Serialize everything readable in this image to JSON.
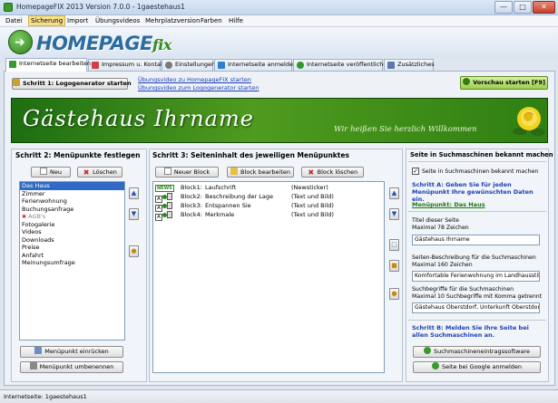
{
  "window": {
    "title": "HomepageFIX 2013 Version 7.0.0 - 1gaestehaus1",
    "controls": {
      "minimize": "—",
      "maximize": "□",
      "close": "✕"
    }
  },
  "menu": [
    {
      "label": "Datei",
      "active": false
    },
    {
      "label": "Sicherung",
      "active": true
    },
    {
      "label": "Import",
      "active": false
    },
    {
      "label": "Übungsvideos",
      "active": false
    },
    {
      "label": "Mehrplatzversion",
      "active": false
    },
    {
      "label": "Farben",
      "active": false
    },
    {
      "label": "Hilfe",
      "active": false
    }
  ],
  "logo": {
    "text": "HOMEPAGE",
    "suffix": "fix"
  },
  "tabs": [
    {
      "label": "Internetseite bearbeiten",
      "active": true,
      "icon": "edit-icon",
      "color": "#3a9a2e"
    },
    {
      "label": "Impressum u. Kontakt",
      "active": false,
      "icon": "contact-icon",
      "color": "#d04040"
    },
    {
      "label": "Einstellungen",
      "active": false,
      "icon": "settings-icon",
      "color": "#7a7a7a"
    },
    {
      "label": "Internetseite anmelden",
      "active": false,
      "icon": "register-icon",
      "color": "#2f7fd0"
    },
    {
      "label": "Internetseite veröffentlichen",
      "active": false,
      "icon": "publish-icon",
      "color": "#2a9a2a"
    },
    {
      "label": "Zusätzliches",
      "active": false,
      "icon": "extras-icon",
      "color": "#5a7ab0"
    }
  ],
  "toolbar": {
    "logo_generator_button": "Schritt 1: Logogenerator starten",
    "video_link_1": "Übungsvideo zu HomepageFIX starten",
    "video_link_2": "Übungsvideo zum Logogenerator starten",
    "preview_button": "Vorschau starten [F9]"
  },
  "banner": {
    "title": "Gästehaus Ihrname",
    "subtitle": "Wir heißen Sie herzlich Willkommen"
  },
  "step2": {
    "title": "Schritt 2: Menüpunkte festlegen",
    "new_button": "Neu",
    "delete_button": "Löschen",
    "items": [
      {
        "label": "Das Haus",
        "selected": true,
        "dim": false
      },
      {
        "label": "Zimmer",
        "selected": false,
        "dim": false
      },
      {
        "label": "Ferienwohnung",
        "selected": false,
        "dim": false
      },
      {
        "label": "Buchungsanfrage",
        "selected": false,
        "dim": false
      },
      {
        "label": "AGB's",
        "selected": false,
        "dim": true
      },
      {
        "label": "Fotogalerie",
        "selected": false,
        "dim": false
      },
      {
        "label": "Videos",
        "selected": false,
        "dim": false
      },
      {
        "label": "Downloads",
        "selected": false,
        "dim": false
      },
      {
        "label": "Preise",
        "selected": false,
        "dim": false
      },
      {
        "label": "Anfahrt",
        "selected": false,
        "dim": false
      },
      {
        "label": "Meinungsumfrage",
        "selected": false,
        "dim": false
      }
    ],
    "indent_button": "Menüpunkt einrücken",
    "rename_button": "Menüpunkt umbenennen"
  },
  "step3": {
    "title": "Schritt 3: Seiteninhalt des jeweiligen Menüpunktes",
    "new_block_button": "Neuer Block",
    "edit_block_button": "Block bearbeiten",
    "delete_block_button": "Block löschen",
    "blocks": [
      {
        "name": "Block1:",
        "title": "Laufschrift",
        "type": "(Newsticker)",
        "news": true
      },
      {
        "name": "Block2:",
        "title": "Beschreibung der Lage",
        "type": "(Text und Bild)",
        "news": false
      },
      {
        "name": "Block3:",
        "title": "Entspannen Sie",
        "type": "(Text und Bild)",
        "news": false
      },
      {
        "name": "Block4:",
        "title": "Merkmale",
        "type": "(Text und Bild)",
        "news": false
      }
    ],
    "news_badge": "NEWS",
    "a_badge": "A"
  },
  "seo": {
    "header": "Seite in Suchmaschinen bekannt machen",
    "checkbox_label": "Seite in Suchmaschinen bekannt machen",
    "checkbox_checked": "✓",
    "step_a": "Schritt A: Geben Sie für jeden Menüpunkt Ihre gewünschten Daten ein.",
    "menu_point_link": "Menüpunkt: Das Haus",
    "title_label": "Titel dieser Seite",
    "title_max": "Maximal 78 Zeichen",
    "title_value": "Gästehaus Ihrname",
    "desc_label": "Seiten-Beschreibung für die Suchmaschinen",
    "desc_max": "Maximal 160 Zeichen",
    "desc_value": "Komfortable Ferienwohnung im Landhausstil in C",
    "keywords_label": "Suchbegriffe für die Suchmaschinen",
    "keywords_max": "Maximal 10 Suchbegriffe mit Komma getrennt",
    "keywords_value": "Gästehaus Oberstdorf, Unterkunft Oberstdorf, Fe",
    "step_b": "Schritt B: Melden Sie Ihre Seite bei allen Suchmaschinen an.",
    "submit_button": "Suchmaschineneintragssoftware",
    "google_button": "Seite bei Google anmelden"
  },
  "status": {
    "text": "Internetseite: 1gaestehaus1"
  }
}
